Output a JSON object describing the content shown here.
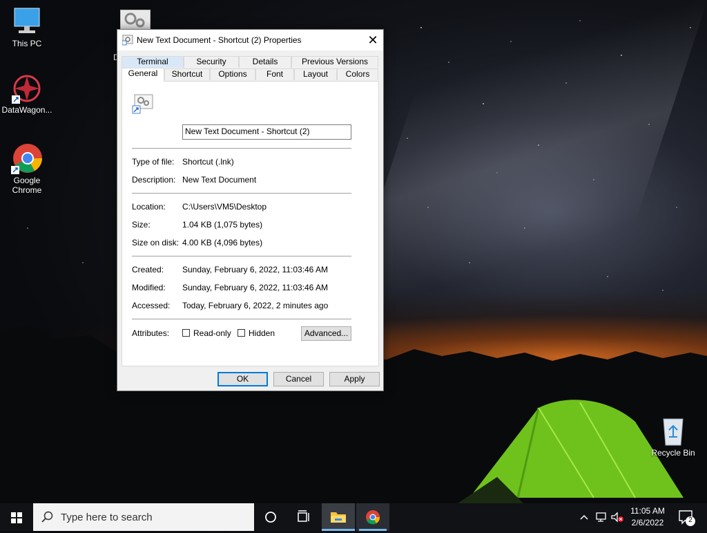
{
  "desktop": {
    "icons": [
      {
        "label": "This PC"
      },
      {
        "label": "DataWagon..."
      },
      {
        "label": "Google Chrome"
      },
      {
        "label": "Recycle Bin"
      }
    ],
    "partial_icon_letter": "D"
  },
  "dialog": {
    "title": "New Text Document - Shortcut (2) Properties",
    "close_symbol": "✕",
    "tabs_row1": [
      "Terminal",
      "Security",
      "Details",
      "Previous Versions"
    ],
    "tabs_row2": [
      "General",
      "Shortcut",
      "Options",
      "Font",
      "Layout",
      "Colors"
    ],
    "active_tab": "General",
    "name_value": "New Text Document - Shortcut (2)",
    "fields": {
      "type_label": "Type of file:",
      "type_value": "Shortcut (.lnk)",
      "desc_label": "Description:",
      "desc_value": "New Text Document",
      "location_label": "Location:",
      "location_value": "C:\\Users\\VM5\\Desktop",
      "size_label": "Size:",
      "size_value": "1.04 KB (1,075 bytes)",
      "sod_label": "Size on disk:",
      "sod_value": "4.00 KB (4,096 bytes)",
      "created_label": "Created:",
      "created_value": "Sunday, February 6, 2022, 11:03:46 AM",
      "modified_label": "Modified:",
      "modified_value": "Sunday, February 6, 2022, 11:03:46 AM",
      "accessed_label": "Accessed:",
      "accessed_value": "Today, February 6, 2022, 2 minutes ago",
      "attributes_label": "Attributes:"
    },
    "attributes": {
      "readonly_label": "Read-only",
      "readonly_checked": false,
      "hidden_label": "Hidden",
      "hidden_checked": false,
      "advanced_label": "Advanced..."
    },
    "buttons": {
      "ok": "OK",
      "cancel": "Cancel",
      "apply": "Apply"
    }
  },
  "taskbar": {
    "search_placeholder": "Type here to search",
    "time": "11:05 AM",
    "date": "2/6/2022",
    "notification_count": "2"
  },
  "colors": {
    "accent": "#0078d7",
    "taskbar": "#101216",
    "tent": "#7dd020"
  }
}
